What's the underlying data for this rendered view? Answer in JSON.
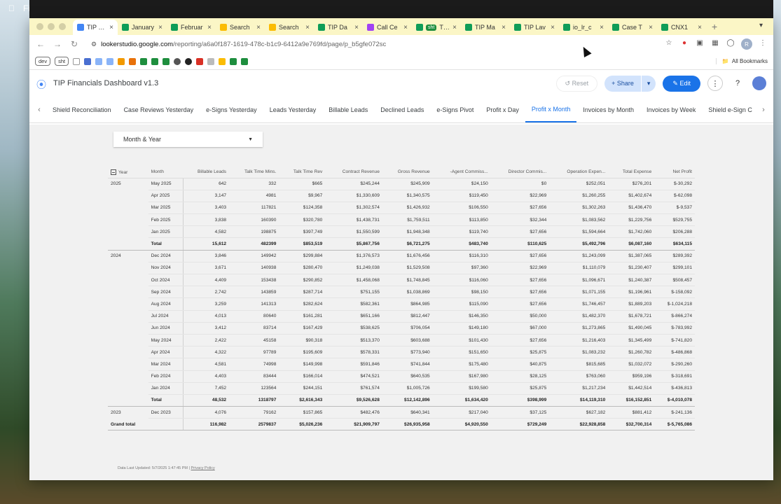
{
  "mac_menu": {
    "apple": "",
    "app": "Fi"
  },
  "browser": {
    "tabs": [
      {
        "title": "TIP Fina",
        "color": "#4285f4",
        "active": true
      },
      {
        "title": "January",
        "color": "#0f9d58"
      },
      {
        "title": "Februar",
        "color": "#0f9d58"
      },
      {
        "title": "Search",
        "color": "#fbbc04"
      },
      {
        "title": "Search",
        "color": "#fbbc04"
      },
      {
        "title": "TIP Da",
        "color": "#0f9d58"
      },
      {
        "title": "Call Ce",
        "color": "#a142f4"
      },
      {
        "title": "TIP P&",
        "color": "#0f9d58",
        "badge": "sht"
      },
      {
        "title": "TIP Ma",
        "color": "#0f9d58"
      },
      {
        "title": "TIP Lav",
        "color": "#0f9d58"
      },
      {
        "title": "io_lr_c",
        "color": "#0f9d58"
      },
      {
        "title": "Case T",
        "color": "#0f9d58"
      },
      {
        "title": "CNX1",
        "color": "#0f9d58"
      }
    ],
    "url_host": "lookerstudio.google.com",
    "url_path": "/reporting/a6a0f187-1619-478c-b1c9-6412a9e769fd/page/p_b5gfe072sc",
    "bookmarks": {
      "chip1": "dev",
      "chip2": "sht",
      "all": "All Bookmarks"
    }
  },
  "header": {
    "title": "TIP Financials Dashboard v1.3",
    "reset": "Reset",
    "share": "Share",
    "edit": "Edit"
  },
  "page_tabs": [
    "Shield Reconciliation",
    "Case Reviews Yesterday",
    "e-Signs Yesterday",
    "Leads Yesterday",
    "Billable Leads",
    "Declined Leads",
    "e-Signs Pivot",
    "Profit x Day",
    "Profit x Month",
    "Invoices by Month",
    "Invoices by Week",
    "Shield e-Sign C"
  ],
  "active_page_tab": "Profit x Month",
  "filter": {
    "label": "Month & Year"
  },
  "table": {
    "columns": [
      "Year",
      "Month",
      "Billable Leads",
      "Talk Time Mins.",
      "Talk Time Rev",
      "Contract Revenue",
      "Gross Revenue",
      "-Agent Commiss...",
      "Director Commis...",
      "Operation Expen...",
      "Total Expense",
      "Net Profit"
    ],
    "rows": [
      {
        "year": "2025",
        "month": "May 2025",
        "v": [
          "642",
          "332",
          "$665",
          "$245,244",
          "$245,909",
          "$24,150",
          "$0",
          "$252,051",
          "$276,201",
          "$-30,292"
        ]
      },
      {
        "year": "",
        "month": "Apr 2025",
        "v": [
          "3,147",
          "4981",
          "$9,967",
          "$1,330,609",
          "$1,340,575",
          "$119,450",
          "$22,969",
          "$1,260,255",
          "$1,402,674",
          "$-62,098"
        ]
      },
      {
        "year": "",
        "month": "Mar 2025",
        "v": [
          "3,403",
          "117821",
          "$124,358",
          "$1,302,574",
          "$1,426,932",
          "$106,550",
          "$27,656",
          "$1,302,263",
          "$1,436,470",
          "$-9,537"
        ]
      },
      {
        "year": "",
        "month": "Feb 2025",
        "v": [
          "3,838",
          "160390",
          "$320,780",
          "$1,438,731",
          "$1,759,511",
          "$113,850",
          "$32,344",
          "$1,083,562",
          "$1,229,756",
          "$529,755"
        ]
      },
      {
        "year": "",
        "month": "Jan 2025",
        "v": [
          "4,582",
          "198875",
          "$397,749",
          "$1,550,599",
          "$1,948,348",
          "$119,740",
          "$27,656",
          "$1,594,664",
          "$1,742,060",
          "$206,288"
        ]
      },
      {
        "year": "",
        "month": "Total",
        "total": true,
        "v": [
          "15,612",
          "482399",
          "$853,519",
          "$5,867,756",
          "$6,721,275",
          "$483,740",
          "$110,625",
          "$5,492,796",
          "$6,087,160",
          "$634,115"
        ]
      },
      {
        "year": "2024",
        "month": "Dec 2024",
        "v": [
          "3,846",
          "149942",
          "$299,884",
          "$1,376,573",
          "$1,676,456",
          "$116,310",
          "$27,656",
          "$1,243,099",
          "$1,387,065",
          "$289,392"
        ]
      },
      {
        "year": "",
        "month": "Nov 2024",
        "v": [
          "3,671",
          "140938",
          "$280,470",
          "$1,249,038",
          "$1,529,508",
          "$97,360",
          "$22,969",
          "$1,110,079",
          "$1,230,407",
          "$299,101"
        ]
      },
      {
        "year": "",
        "month": "Oct 2024",
        "v": [
          "4,409",
          "153438",
          "$290,852",
          "$1,458,068",
          "$1,748,845",
          "$116,060",
          "$27,656",
          "$1,096,671",
          "$1,240,387",
          "$508,457"
        ]
      },
      {
        "year": "",
        "month": "Sep 2024",
        "v": [
          "2,742",
          "143859",
          "$287,714",
          "$751,155",
          "$1,038,869",
          "$98,150",
          "$27,656",
          "$1,071,155",
          "$1,196,961",
          "$-158,092"
        ]
      },
      {
        "year": "",
        "month": "Aug 2024",
        "v": [
          "3,259",
          "141313",
          "$282,624",
          "$582,361",
          "$864,985",
          "$115,090",
          "$27,656",
          "$1,746,457",
          "$1,889,203",
          "$-1,024,218"
        ]
      },
      {
        "year": "",
        "month": "Jul 2024",
        "v": [
          "4,013",
          "80640",
          "$161,281",
          "$651,166",
          "$812,447",
          "$146,350",
          "$50,000",
          "$1,482,370",
          "$1,678,721",
          "$-866,274"
        ]
      },
      {
        "year": "",
        "month": "Jun 2024",
        "v": [
          "3,412",
          "83714",
          "$167,429",
          "$538,625",
          "$706,054",
          "$149,180",
          "$67,000",
          "$1,273,865",
          "$1,490,045",
          "$-783,992"
        ]
      },
      {
        "year": "",
        "month": "May 2024",
        "v": [
          "2,422",
          "45158",
          "$90,318",
          "$513,370",
          "$603,688",
          "$101,430",
          "$27,656",
          "$1,216,403",
          "$1,345,499",
          "$-741,820"
        ]
      },
      {
        "year": "",
        "month": "Apr 2024",
        "v": [
          "4,322",
          "97789",
          "$195,609",
          "$578,331",
          "$773,940",
          "$151,650",
          "$25,875",
          "$1,083,232",
          "$1,260,782",
          "$-486,868"
        ]
      },
      {
        "year": "",
        "month": "Mar 2024",
        "v": [
          "4,581",
          "74998",
          "$149,998",
          "$591,846",
          "$741,844",
          "$175,480",
          "$40,875",
          "$815,685",
          "$1,032,072",
          "$-290,260"
        ]
      },
      {
        "year": "",
        "month": "Feb 2024",
        "v": [
          "4,403",
          "83444",
          "$166,014",
          "$474,521",
          "$640,535",
          "$167,980",
          "$28,125",
          "$763,060",
          "$959,196",
          "$-318,691"
        ]
      },
      {
        "year": "",
        "month": "Jan 2024",
        "v": [
          "7,452",
          "123564",
          "$244,151",
          "$761,574",
          "$1,005,726",
          "$199,580",
          "$25,875",
          "$1,217,234",
          "$1,442,514",
          "$-436,813"
        ]
      },
      {
        "year": "",
        "month": "Total",
        "total": true,
        "v": [
          "48,532",
          "1318797",
          "$2,616,343",
          "$9,526,628",
          "$12,142,896",
          "$1,634,420",
          "$398,999",
          "$14,119,310",
          "$16,152,851",
          "$-4,010,078"
        ]
      },
      {
        "year": "2023",
        "month": "Dec 2023",
        "v": [
          "4,076",
          "79162",
          "$157,865",
          "$482,476",
          "$640,341",
          "$217,040",
          "$37,125",
          "$627,182",
          "$881,412",
          "$-241,136"
        ]
      },
      {
        "year": "Grand total",
        "month": "",
        "grand": true,
        "v": [
          "116,982",
          "2579837",
          "$5,026,236",
          "$21,909,797",
          "$26,935,958",
          "$4,920,550",
          "$729,249",
          "$22,928,858",
          "$32,700,314",
          "$-5,765,086"
        ]
      }
    ]
  },
  "footer": {
    "updated": "Data Last Updated: 5/7/2025 1:47:45 PM",
    "sep": "|",
    "privacy": "Privacy Policy"
  }
}
